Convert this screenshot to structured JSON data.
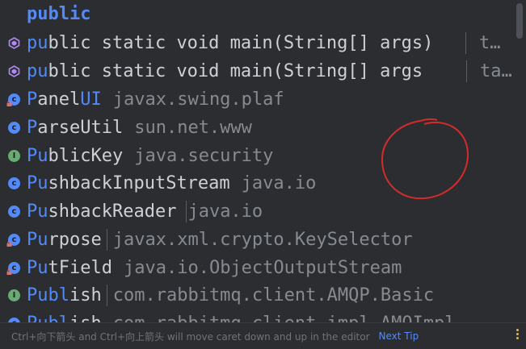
{
  "popup": {
    "query": "public",
    "items": [
      {
        "icon": "method-icon",
        "match": "pu",
        "rest": "blic static void main(String[] args)",
        "tail": "t…",
        "kind": "method"
      },
      {
        "icon": "method-icon",
        "match": "pu",
        "rest": "blic static void main(String[] args",
        "tail": "ta…",
        "kind": "method"
      },
      {
        "icon": "class-icon",
        "match": "P",
        "mid": "anel",
        "match2": "UI",
        "pkg": "javax.swing.plaf",
        "kind": "class"
      },
      {
        "icon": "class-icon",
        "match": "P",
        "rest": "arseUtil",
        "pkg": "sun.net.www",
        "kind": "class"
      },
      {
        "icon": "interface-icon",
        "match": "Pu",
        "rest": "blicKey",
        "pkg": "java.security",
        "kind": "interface"
      },
      {
        "icon": "class-icon",
        "match": "Pu",
        "rest": "shbackInputStream",
        "pkg": "java.io",
        "kind": "class"
      },
      {
        "icon": "class-icon",
        "match": "Pu",
        "rest": "shbackReader",
        "pkg": "java.io",
        "kind": "class"
      },
      {
        "icon": "class-icon",
        "match": "Pu",
        "rest": "rpose",
        "pkg": "javax.xml.crypto.KeySelector",
        "kind": "class"
      },
      {
        "icon": "class-icon",
        "match": "Pu",
        "rest": "tField",
        "pkg": "java.io.ObjectOutputStream",
        "kind": "class"
      },
      {
        "icon": "interface-icon",
        "match": "Publ",
        "rest": "ish",
        "pkg": "com.rabbitmq.client.AMQP.Basic",
        "kind": "interface"
      },
      {
        "icon": "class-icon",
        "match": "Publ",
        "rest": "ish",
        "pkg": "com.rabbitmq.client.impl.AMQImpl",
        "kind": "class"
      }
    ]
  },
  "footer": {
    "hint": "Ctrl+向下箭头 and Ctrl+向上箭头 will move caret down and up in the editor",
    "link": "Next Tip"
  },
  "colors": {
    "background": "#2b2d30",
    "selection": "#2e436e",
    "match": "#548af7",
    "package": "#868a91",
    "annotation_circle": "#d62b2b"
  }
}
